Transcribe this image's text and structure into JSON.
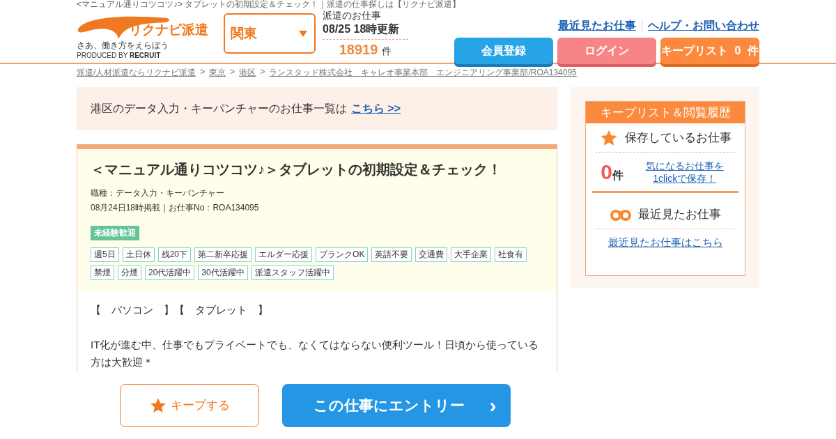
{
  "page_title": "<マニュアル通りコツコツ♪> タブレットの初期設定＆チェック！｜派遣の仕事探しは【リクナビ派遣】",
  "header": {
    "logo_text": "リクナビ派遣",
    "tagline": "さあ、働き方をえらぼう",
    "produced_by": "PRODUCED BY",
    "produced_brand": "RECRUIT",
    "region": {
      "value": "関東"
    },
    "update": {
      "label": "派遣のお仕事",
      "date": "08/25 18時更新",
      "count": "18919",
      "unit": "件"
    },
    "links": [
      "最近見たお仕事",
      "ヘルプ・お問い合わせ"
    ],
    "buttons": [
      {
        "kind": "register",
        "label": "会員登録"
      },
      {
        "kind": "login",
        "label": "ログイン"
      },
      {
        "kind": "keeplist",
        "label": "キープリスト",
        "count": "0",
        "unit": "件"
      }
    ]
  },
  "breadcrumb": {
    "separator": ">",
    "items": [
      "派遣/人材派遣ならリクナビ派遣",
      "東京",
      "港区",
      "ランスタッド株式会社　キャレオ事業本部　エンジニアリング事業部/ROA134095"
    ]
  },
  "notice": {
    "text": "港区のデータ入力・キーパンチャーのお仕事一覧は",
    "link": "こちら >>"
  },
  "job": {
    "title": "＜マニュアル通りコツコツ♪＞タブレットの初期設定＆チェック！",
    "category": "職種：データ入力・キーパンチャー",
    "posted": "08月24日18時掲載｜お仕事No：ROA134095",
    "badge": "未経験歓迎",
    "tags": [
      "週5日",
      "土日休",
      "残20下",
      "第二新卒応援",
      "エルダー応援",
      "ブランクOK",
      "英語不要",
      "交通費",
      "大手企業",
      "社食有",
      "禁煙",
      "分煙",
      "20代活躍中",
      "30代活躍中",
      "派遣スタッフ活躍中"
    ],
    "body": [
      "【　パソコン　】【　タブレット　】",
      "IT化が進む中、仕事でもプライベートでも、なくてはならない便利ツール！日頃から使っている方は大歓迎＊"
    ]
  },
  "action_bar": {
    "keep": "キープする",
    "entry": "この仕事にエントリー",
    "entry_arrow": "›"
  },
  "sidebar": {
    "title": "キープリスト＆閲覧履歴",
    "saved_heading": "保存しているお仕事",
    "saved_count": "0",
    "saved_unit": "件",
    "saved_link": "気になるお仕事を1clickで保存！",
    "recent_heading": "最近見たお仕事",
    "recent_link": "最近見たお仕事はこちら"
  }
}
